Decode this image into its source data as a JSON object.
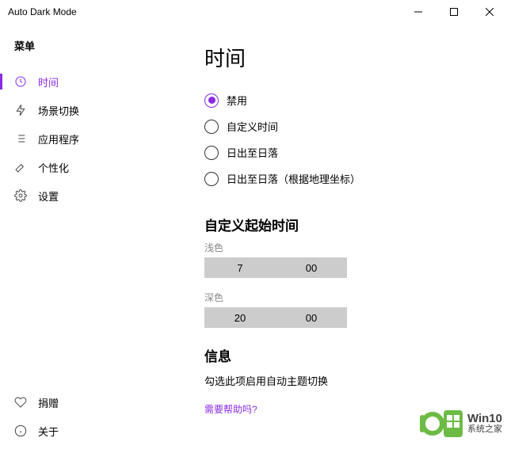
{
  "titlebar": {
    "title": "Auto Dark Mode"
  },
  "sidebar": {
    "heading": "菜单",
    "items": [
      {
        "label": "时间"
      },
      {
        "label": "场景切换"
      },
      {
        "label": "应用程序"
      },
      {
        "label": "个性化"
      },
      {
        "label": "设置"
      }
    ],
    "bottom": [
      {
        "label": "捐赠"
      },
      {
        "label": "关于"
      }
    ]
  },
  "main": {
    "title": "时间",
    "radios": [
      {
        "label": "禁用"
      },
      {
        "label": "自定义时间"
      },
      {
        "label": "日出至日落"
      },
      {
        "label": "日出至日落（根据地理坐标）"
      }
    ],
    "custom_time": {
      "heading": "自定义起始时间",
      "light": {
        "label": "浅色",
        "hour": "7",
        "minute": "00"
      },
      "dark": {
        "label": "深色",
        "hour": "20",
        "minute": "00"
      }
    },
    "info": {
      "heading": "信息",
      "text": "勾选此项启用自动主题切换",
      "help": "需要帮助吗?"
    }
  },
  "watermark": {
    "line1": "Win10",
    "line2": "系统之家"
  }
}
